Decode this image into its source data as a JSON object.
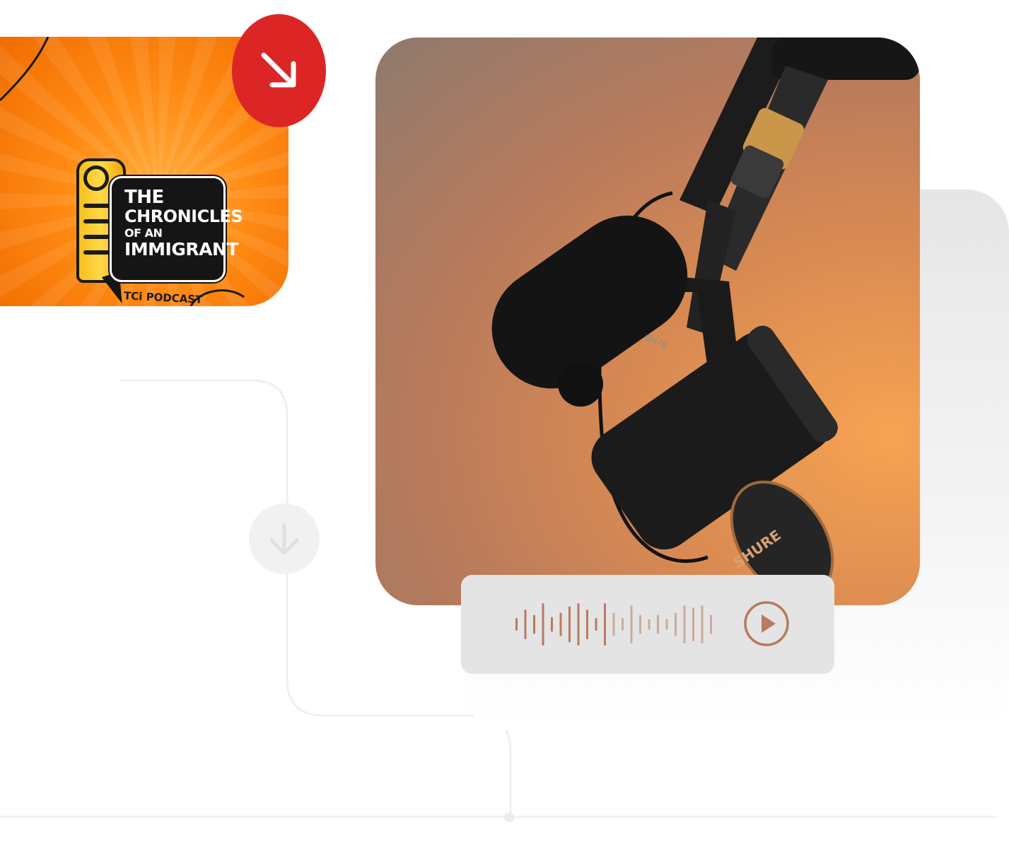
{
  "podcast_cover": {
    "title_line1": "THE",
    "title_line2": "CHRONICLES",
    "title_line3": "OF AN",
    "title_line4": "IMMIGRANT",
    "subtitle": "TCi PODCAST"
  },
  "badge": {
    "icon": "arrow-down-right-icon",
    "color": "#dc2626"
  },
  "download_marker": {
    "icon": "arrow-down-icon"
  },
  "photo": {
    "subject": "microphone",
    "brand_label": "SHURE",
    "model_label": "SM7B"
  },
  "player": {
    "play_icon": "play-icon",
    "accent_color": "#b87a62",
    "wave_levels": [
      0.3,
      0.7,
      0.45,
      1.0,
      0.35,
      0.55,
      0.85,
      1.0,
      0.7,
      0.3,
      1.0,
      0.55,
      0.3,
      0.9,
      0.45,
      0.25,
      0.45,
      0.25,
      0.55,
      0.9,
      0.8,
      0.9,
      0.45
    ]
  }
}
